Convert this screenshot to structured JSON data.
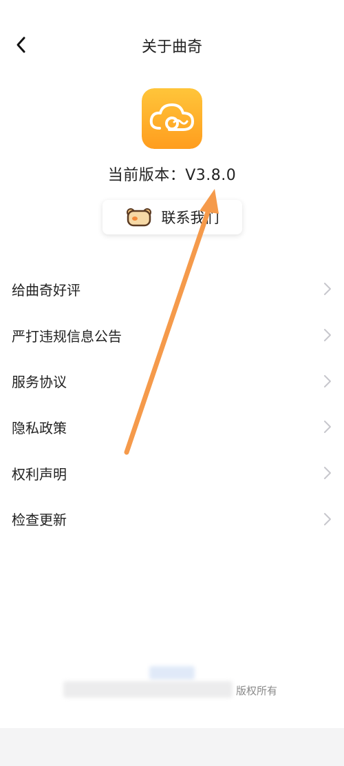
{
  "header": {
    "title": "关于曲奇",
    "back_icon": "chevron-left-icon"
  },
  "app": {
    "logo_icon": "cloud-logo-icon",
    "version_text": "当前版本：V3.8.0"
  },
  "contact": {
    "icon": "bear-face-icon",
    "label": "联系我们"
  },
  "menu": {
    "items": [
      {
        "label": "给曲奇好评"
      },
      {
        "label": "严打违规信息公告"
      },
      {
        "label": "服务协议"
      },
      {
        "label": "隐私政策"
      },
      {
        "label": "权利声明"
      },
      {
        "label": "检查更新"
      }
    ]
  },
  "footer": {
    "copyright_visible": "版权所有"
  },
  "colors": {
    "logo_gradient_top": "#FFC53A",
    "logo_gradient_bottom": "#FF9D1E",
    "arrow": "#F59A4B",
    "chevron": "#C7C7CC"
  }
}
